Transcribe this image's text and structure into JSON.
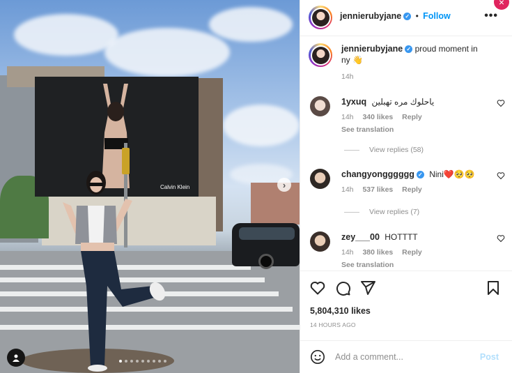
{
  "post": {
    "username": "jennierubyjane",
    "follow_label": "Follow",
    "more_label": "•••",
    "caption_text": "proud moment in ny 👋",
    "caption_time": "14h",
    "likes": "5,804,310 likes",
    "time_ago": "14 HOURS AGO"
  },
  "photo": {
    "billboard_brand": "Calvin Klein",
    "carousel_total": 9,
    "carousel_active": 1
  },
  "comments": [
    {
      "username": "1yxuq",
      "text": "ياحلوك مره تهبلين",
      "time": "14h",
      "likes": "340 likes",
      "reply_label": "Reply",
      "see_translation": "See translation",
      "view_replies": "View replies (58)"
    },
    {
      "username": "changyongggggg",
      "text": "Nini❤️🥺🥺",
      "time": "14h",
      "likes": "537 likes",
      "reply_label": "Reply",
      "view_replies": "View replies (7)"
    },
    {
      "username": "zey___00",
      "text": "HOTTTT",
      "time": "14h",
      "likes": "380 likes",
      "reply_label": "Reply",
      "see_translation": "See translation"
    }
  ],
  "add_comment": {
    "placeholder": "Add a comment...",
    "post_label": "Post"
  },
  "close_label": "×",
  "nav_next_label": "›",
  "verified_mark": "✓",
  "colors": {
    "accent": "#0095f6",
    "verified": "#3897f0",
    "post_disabled": "#b2dffc",
    "muted": "#8e8e8e"
  },
  "icons": [
    "heart-icon",
    "comment-icon",
    "share-icon",
    "bookmark-icon",
    "emoji-icon",
    "more-icon",
    "chevron-right-icon",
    "user-tag-icon",
    "close-icon"
  ]
}
